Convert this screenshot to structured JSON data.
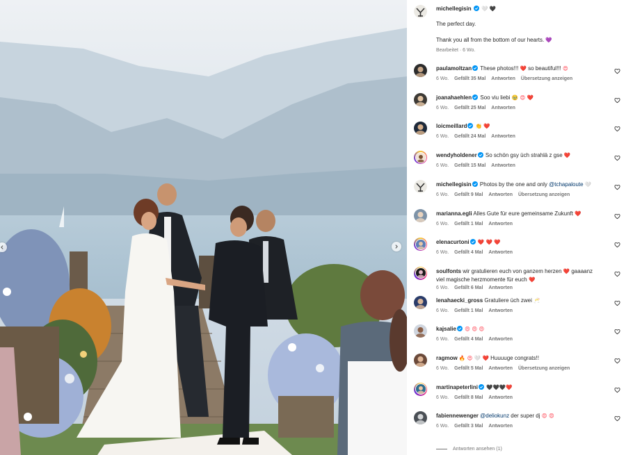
{
  "post": {
    "author": "michellegisin",
    "author_emoji": "🤍 🖤",
    "caption_line1": "The perfect day.",
    "caption_line2": "Thank you all from the bottom of our hearts.",
    "caption_line2_emoji": "💜",
    "edited": "Bearbeitet · 6 Wo."
  },
  "comments": [
    {
      "user": "paulamoltzan",
      "verified": true,
      "text": "These photos!!!",
      "emoji1": "❤️",
      "text2": " so beautiful!!!",
      "emoji2": "😍",
      "age": "6 Wo.",
      "likes": "Gefällt 35 Mal",
      "reply": "Antworten",
      "translate": "Übersetzung anzeigen"
    },
    {
      "user": "joanahaehlen",
      "verified": true,
      "text": "Soo viu liebi",
      "emoji1": "🥹 😍 ❤️",
      "age": "6 Wo.",
      "likes": "Gefällt 25 Mal",
      "reply": "Antworten"
    },
    {
      "user": "loicmeillard",
      "verified": true,
      "text": "",
      "emoji1": "👏 ❤️",
      "age": "6 Wo.",
      "likes": "Gefällt 24 Mal",
      "reply": "Antworten"
    },
    {
      "user": "wendyholdener",
      "verified": true,
      "text": "So schön gsy üch strahlä z gse",
      "emoji1": "❤️",
      "age": "6 Wo.",
      "likes": "Gefällt 15 Mal",
      "reply": "Antworten"
    },
    {
      "user": "michellegisin",
      "verified": true,
      "text": "Photos by the one and only",
      "mention": "@tchapaloute",
      "emoji1": "🤍",
      "age": "6 Wo.",
      "likes": "Gefällt 9 Mal",
      "reply": "Antworten",
      "translate": "Übersetzung anzeigen"
    },
    {
      "user": "marianna.egli",
      "verified": false,
      "text": "Alles Gute für eure gemeinsame Zukunft",
      "emoji1": "❤️",
      "age": "6 Wo.",
      "likes": "Gefällt 1 Mal",
      "reply": "Antworten"
    },
    {
      "user": "elenacurtoni",
      "verified": true,
      "text": "",
      "emoji1": "❤️ ❤️ ❤️",
      "age": "6 Wo.",
      "likes": "Gefällt 4 Mal",
      "reply": "Antworten"
    },
    {
      "user": "soulfonts",
      "verified": false,
      "text": "wir gratulieren euch von ganzem herzen",
      "emoji1": "❤️",
      "text2": " gaaaanz",
      "line2": "viel magische herzmomente für euch",
      "emoji2": "❤️",
      "age": "6 Wo.",
      "likes": "Gefällt 6 Mal",
      "reply": "Antworten"
    },
    {
      "user": "lenahaecki_gross",
      "verified": false,
      "text": "Gratuliere üch zwei",
      "emoji1": "🥂",
      "age": "6 Wo.",
      "likes": "Gefällt 1 Mal",
      "reply": "Antworten"
    },
    {
      "user": "kajsalie",
      "verified": true,
      "text": "",
      "emoji1": "😍 😍 😍",
      "age": "6 Wo.",
      "likes": "Gefällt 4 Mal",
      "reply": "Antworten"
    },
    {
      "user": "ragmow",
      "verified": false,
      "text": "",
      "emoji1": "🔥 😍 🤍 ❤️",
      "text2": " Huuuuge congrats!!",
      "age": "6 Wo.",
      "likes": "Gefällt 5 Mal",
      "reply": "Antworten",
      "translate": "Übersetzung anzeigen"
    },
    {
      "user": "martinapeterlini",
      "verified": true,
      "text": "",
      "emoji1": "🖤🖤🖤❤️",
      "age": "6 Wo.",
      "likes": "Gefällt 8 Mal",
      "reply": "Antworten"
    },
    {
      "user": "fabiennewenger",
      "verified": false,
      "mention": "@deliokunz",
      "text": " der super dj",
      "emoji1": "😍 😍",
      "age": "6 Wo.",
      "likes": "Gefällt 3 Mal",
      "reply": "Antworten"
    }
  ],
  "view_replies": "Antworten ansehen (1)",
  "colors": {
    "accent_link": "#00376b",
    "verified_blue": "#0095f6",
    "meta_gray": "#737373",
    "heart_red": "#ff3040"
  },
  "icons": [
    "chevron-left-icon",
    "chevron-right-icon",
    "verified-badge-icon",
    "heart-outline-icon"
  ]
}
